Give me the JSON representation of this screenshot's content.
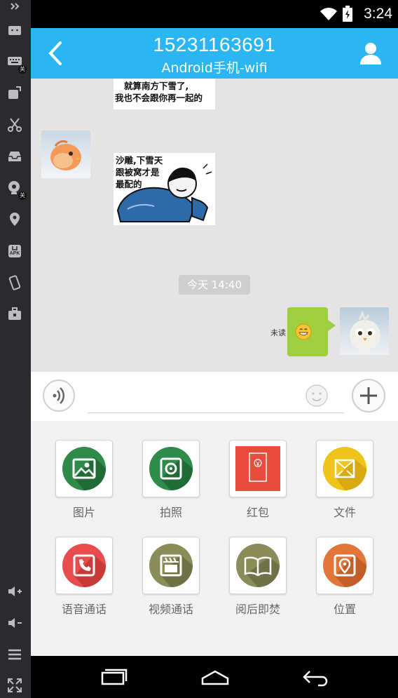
{
  "status_bar": {
    "time": "3:24"
  },
  "header": {
    "title": "15231163691",
    "subtitle": "Android手机-wifi"
  },
  "chat": {
    "messages": [
      {
        "sender": "contact",
        "type": "sticker",
        "text_line1": "就算南方下雪了,",
        "text_line2": "我也不会跟你再一起的"
      },
      {
        "sender": "contact",
        "type": "sticker",
        "text_line1": "沙雕,下雪天",
        "text_line2": "跟被窝才是",
        "text_line3": "最配的"
      },
      {
        "sender": "me",
        "type": "emoji",
        "status": "未读"
      }
    ],
    "timestamp": "今天  14:40"
  },
  "input": {
    "placeholder": ""
  },
  "panel": {
    "items": [
      {
        "label": "图片",
        "icon": "image-icon",
        "color": "#2e8b4a"
      },
      {
        "label": "拍照",
        "icon": "camera-icon",
        "color": "#2e8b4a"
      },
      {
        "label": "红包",
        "icon": "red-envelope-icon",
        "color": "#e84c3d"
      },
      {
        "label": "文件",
        "icon": "file-icon",
        "color": "#f0c419"
      },
      {
        "label": "语音通话",
        "icon": "phone-icon",
        "color": "#e84c4c"
      },
      {
        "label": "视频通话",
        "icon": "video-icon",
        "color": "#8a8d5a"
      },
      {
        "label": "阅后即焚",
        "icon": "book-icon",
        "color": "#8a8d5a"
      },
      {
        "label": "位置",
        "icon": "location-icon",
        "color": "#e2763a"
      }
    ]
  },
  "colors": {
    "header": "#2bb5f2",
    "chat_bg": "#e4e4e4",
    "bubble": "#9fce3e"
  }
}
